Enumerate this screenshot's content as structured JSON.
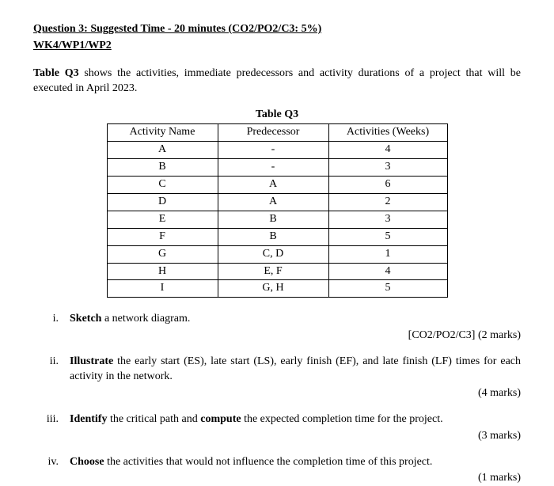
{
  "header": {
    "title_prefix": "Question 3: Suggested Time - 20 minutes (CO2/PO2/C3: 5%)",
    "codes": "WK4/WP1/WP2"
  },
  "intro": {
    "bold_lead": "Table Q3",
    "rest": " shows the activities, immediate predecessors and activity durations of a project that will be executed in April 2023."
  },
  "table": {
    "title": "Table Q3",
    "headers": {
      "name": "Activity Name",
      "pred": "Predecessor",
      "dur": "Activities (Weeks)"
    },
    "rows": [
      {
        "name": "A",
        "pred": "-",
        "dur": "4"
      },
      {
        "name": "B",
        "pred": "-",
        "dur": "3"
      },
      {
        "name": "C",
        "pred": "A",
        "dur": "6"
      },
      {
        "name": "D",
        "pred": "A",
        "dur": "2"
      },
      {
        "name": "E",
        "pred": "B",
        "dur": "3"
      },
      {
        "name": "F",
        "pred": "B",
        "dur": "5"
      },
      {
        "name": "G",
        "pred": "C, D",
        "dur": "1"
      },
      {
        "name": "H",
        "pred": "E, F",
        "dur": "4"
      },
      {
        "name": "I",
        "pred": "G, H",
        "dur": "5"
      }
    ]
  },
  "parts": {
    "i": {
      "roman": "i.",
      "bold1": "Sketch",
      "rest1": " a network diagram.",
      "marks": "[CO2/PO2/C3] (2 marks)"
    },
    "ii": {
      "roman": "ii.",
      "bold1": "Illustrate",
      "rest1": " the early start (ES), late start (LS), early finish (EF), and late finish (LF) times for each activity in the network.",
      "marks": "(4 marks)"
    },
    "iii": {
      "roman": "iii.",
      "bold1": "Identify",
      "mid": " the critical path and ",
      "bold2": "compute",
      "rest2": " the expected completion time for the project.",
      "marks": "(3 marks)"
    },
    "iv": {
      "roman": "iv.",
      "bold1": "Choose",
      "rest1": " the activities that would not influence the completion time of this project.",
      "marks": "(1 marks)"
    }
  },
  "chart_data": {
    "type": "table",
    "title": "Table Q3",
    "columns": [
      "Activity Name",
      "Predecessor",
      "Activities (Weeks)"
    ],
    "rows": [
      [
        "A",
        "-",
        4
      ],
      [
        "B",
        "-",
        3
      ],
      [
        "C",
        "A",
        6
      ],
      [
        "D",
        "A",
        2
      ],
      [
        "E",
        "B",
        3
      ],
      [
        "F",
        "B",
        5
      ],
      [
        "G",
        "C, D",
        1
      ],
      [
        "H",
        "E, F",
        4
      ],
      [
        "I",
        "G, H",
        5
      ]
    ]
  }
}
